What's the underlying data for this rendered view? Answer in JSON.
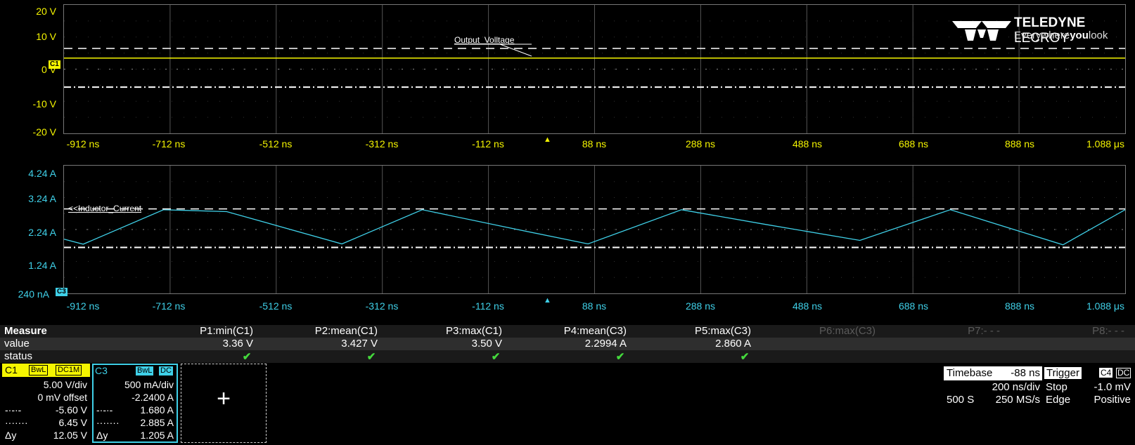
{
  "brand": {
    "name_bold": "TELEDYNE",
    "name_rest": " LECROY",
    "tag_pre": "Everywhere",
    "tag_bold": "you",
    "tag_post": "look"
  },
  "channel1": {
    "color": "#f5f500",
    "trace_label": "Output_Volltage",
    "marker": "C1",
    "y_labels": [
      "20 V",
      "10 V",
      "0 V",
      "-10 V",
      "-20 V"
    ],
    "x_labels": [
      "-912 ns",
      "-712 ns",
      "-512 ns",
      "-312 ns",
      "-112 ns",
      "88 ns",
      "288 ns",
      "488 ns",
      "688 ns",
      "888 ns",
      "1.088 μs"
    ]
  },
  "channel3": {
    "color": "#3fd0e8",
    "trace_label": "<<Inductor_Current",
    "marker": "C3",
    "y_labels": [
      "4.24 A",
      "3.24 A",
      "2.24 A",
      "1.24 A",
      "240 nA"
    ],
    "x_labels": [
      "-912 ns",
      "-712 ns",
      "-512 ns",
      "-312 ns",
      "-112 ns",
      "88 ns",
      "288 ns",
      "488 ns",
      "688 ns",
      "888 ns",
      "1.088 μs"
    ]
  },
  "measure": {
    "title": "Measure",
    "row_value": "value",
    "row_status": "status",
    "params": [
      {
        "name": "P1:min(C1)",
        "value": "3.36 V",
        "ok": true
      },
      {
        "name": "P2:mean(C1)",
        "value": "3.427 V",
        "ok": true
      },
      {
        "name": "P3:max(C1)",
        "value": "3.50 V",
        "ok": true
      },
      {
        "name": "P4:mean(C3)",
        "value": "2.2994 A",
        "ok": true
      },
      {
        "name": "P5:max(C3)",
        "value": "2.860 A",
        "ok": true
      },
      {
        "name": "P6:max(C3)",
        "value": "",
        "ok": false
      },
      {
        "name": "P7:- - -",
        "value": "",
        "ok": false
      },
      {
        "name": "P8:- - -",
        "value": "",
        "ok": false
      }
    ],
    "check_glyph": "✔"
  },
  "c1_box": {
    "name": "C1",
    "chip1": "BwL",
    "chip2": "DC1M",
    "vdiv": "5.00 V/div",
    "offset": "0 mV offset",
    "c1_sym": "-·-·-",
    "c1_val": "-5.60 V",
    "c2_sym": "·······",
    "c2_val": "6.45 V",
    "dy_sym": "Δy",
    "dy_val": "12.05 V"
  },
  "c3_box": {
    "name": "C3",
    "chip1": "BwL",
    "chip2": "DC",
    "vdiv": "500 mA/div",
    "offset": "-2.2400 A",
    "c1_sym": "-·-·-",
    "c1_val": "1.680 A",
    "c2_sym": "·······",
    "c2_val": "2.885 A",
    "dy_sym": "Δy",
    "dy_val": "1.205 A"
  },
  "add_box": {
    "symbol": "+"
  },
  "timebase": {
    "label": "Timebase",
    "delay": "-88 ns",
    "tdiv": "200 ns/div",
    "samples": "500 S",
    "rate": "250 MS/s"
  },
  "trigger": {
    "label": "Trigger",
    "src": "C4",
    "coupling": "DC",
    "mode": "Stop",
    "level": "-1.0 mV",
    "type": "Edge",
    "slope": "Positive"
  },
  "chart_data": [
    {
      "type": "line",
      "ylim": [
        -20,
        20
      ],
      "x": [
        -1012,
        1088
      ],
      "series": [
        {
          "values": [
            3.43,
            3.43
          ]
        }
      ]
    },
    {
      "type": "line",
      "ylim": [
        0.24,
        4.24
      ],
      "x": [
        -1012,
        -974,
        -815,
        -690,
        -462,
        -303,
        -133,
        25,
        210,
        376,
        563,
        742,
        965,
        1088
      ],
      "series": [
        {
          "values": [
            1.94,
            1.78,
            2.86,
            2.8,
            1.79,
            2.86,
            2.3,
            1.79,
            2.86,
            2.4,
            1.9,
            2.86,
            1.76,
            2.86
          ]
        }
      ]
    }
  ]
}
